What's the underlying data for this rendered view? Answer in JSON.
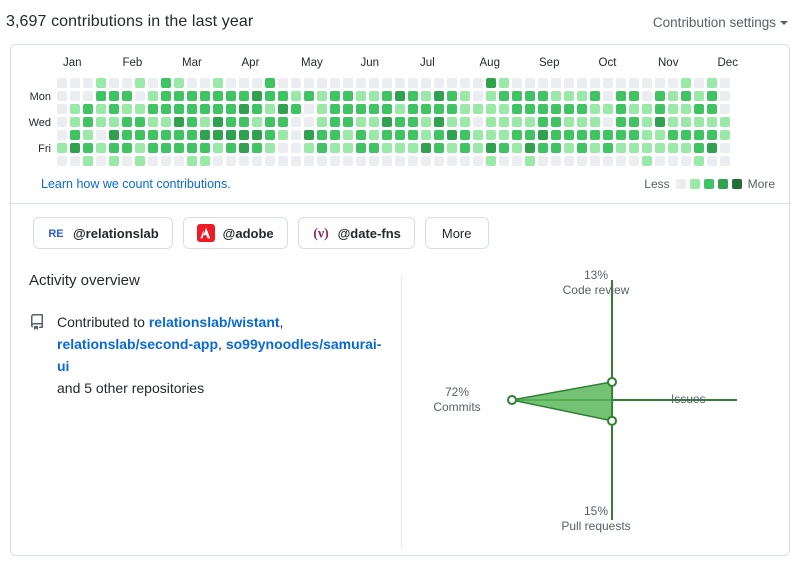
{
  "header": {
    "title": "3,697 contributions in the last year",
    "settings_label": "Contribution settings"
  },
  "calendar": {
    "months": [
      "Jan",
      "Feb",
      "Mar",
      "Apr",
      "May",
      "Jun",
      "Jul",
      "Aug",
      "Sep",
      "Oct",
      "Nov",
      "Dec"
    ],
    "days": [
      "Mon",
      "Wed",
      "Fri"
    ],
    "learn_link": "Learn how we count contributions.",
    "legend": {
      "less_label": "Less",
      "more_label": "More",
      "colors": [
        "#ebedf0",
        "#9be9a8",
        "#40c463",
        "#30a14e",
        "#216e39"
      ]
    },
    "levels": [
      [
        0,
        0,
        0,
        0,
        0,
        1,
        0
      ],
      [
        0,
        0,
        1,
        1,
        2,
        3,
        0
      ],
      [
        0,
        0,
        2,
        2,
        1,
        2,
        1
      ],
      [
        1,
        2,
        1,
        1,
        0,
        1,
        0
      ],
      [
        0,
        2,
        2,
        1,
        3,
        2,
        1
      ],
      [
        0,
        2,
        1,
        2,
        2,
        2,
        0
      ],
      [
        1,
        0,
        1,
        2,
        2,
        1,
        1
      ],
      [
        0,
        1,
        2,
        1,
        2,
        2,
        0
      ],
      [
        2,
        2,
        2,
        1,
        2,
        2,
        0
      ],
      [
        1,
        2,
        2,
        3,
        2,
        2,
        0
      ],
      [
        0,
        2,
        2,
        2,
        2,
        2,
        1
      ],
      [
        0,
        2,
        2,
        1,
        3,
        2,
        1
      ],
      [
        1,
        2,
        2,
        3,
        3,
        1,
        0
      ],
      [
        0,
        2,
        2,
        2,
        3,
        2,
        0
      ],
      [
        0,
        2,
        3,
        2,
        3,
        3,
        0
      ],
      [
        0,
        3,
        2,
        1,
        3,
        2,
        0
      ],
      [
        2,
        2,
        1,
        2,
        2,
        1,
        0
      ],
      [
        0,
        2,
        3,
        2,
        1,
        0,
        0
      ],
      [
        0,
        1,
        2,
        0,
        0,
        0,
        0
      ],
      [
        0,
        2,
        0,
        0,
        3,
        1,
        0
      ],
      [
        0,
        1,
        1,
        1,
        2,
        2,
        0
      ],
      [
        0,
        2,
        2,
        2,
        2,
        1,
        0
      ],
      [
        0,
        2,
        2,
        2,
        1,
        1,
        0
      ],
      [
        0,
        1,
        2,
        1,
        2,
        2,
        0
      ],
      [
        0,
        1,
        2,
        1,
        1,
        2,
        0
      ],
      [
        0,
        2,
        2,
        3,
        2,
        1,
        0
      ],
      [
        0,
        3,
        1,
        2,
        2,
        1,
        0
      ],
      [
        0,
        2,
        2,
        2,
        2,
        1,
        0
      ],
      [
        0,
        1,
        2,
        1,
        1,
        3,
        0
      ],
      [
        0,
        3,
        2,
        3,
        2,
        2,
        0
      ],
      [
        0,
        2,
        2,
        1,
        3,
        1,
        0
      ],
      [
        0,
        1,
        1,
        1,
        2,
        2,
        0
      ],
      [
        0,
        0,
        1,
        0,
        1,
        1,
        0
      ],
      [
        3,
        1,
        1,
        1,
        1,
        3,
        1
      ],
      [
        1,
        2,
        1,
        1,
        1,
        2,
        0
      ],
      [
        0,
        2,
        2,
        1,
        2,
        1,
        0
      ],
      [
        0,
        2,
        2,
        1,
        2,
        3,
        1
      ],
      [
        0,
        2,
        2,
        2,
        3,
        2,
        0
      ],
      [
        0,
        1,
        2,
        2,
        2,
        2,
        0
      ],
      [
        0,
        1,
        2,
        1,
        2,
        1,
        0
      ],
      [
        0,
        1,
        2,
        1,
        2,
        2,
        0
      ],
      [
        0,
        2,
        1,
        1,
        2,
        1,
        0
      ],
      [
        0,
        0,
        1,
        0,
        2,
        2,
        0
      ],
      [
        0,
        2,
        2,
        2,
        2,
        1,
        0
      ],
      [
        0,
        2,
        1,
        2,
        2,
        1,
        0
      ],
      [
        0,
        0,
        1,
        1,
        1,
        1,
        1
      ],
      [
        0,
        2,
        2,
        3,
        1,
        1,
        0
      ],
      [
        0,
        1,
        1,
        1,
        2,
        1,
        0
      ],
      [
        1,
        2,
        1,
        1,
        2,
        1,
        0
      ],
      [
        0,
        1,
        2,
        1,
        2,
        2,
        1
      ],
      [
        1,
        2,
        2,
        1,
        2,
        3,
        0
      ],
      [
        0,
        0,
        0,
        1,
        1,
        0,
        0
      ]
    ]
  },
  "organizations": [
    {
      "name": "@relationslab",
      "icon": "relationslab-logo-icon"
    },
    {
      "name": "@adobe",
      "icon": "adobe-logo-icon"
    },
    {
      "name": "@date-fns",
      "icon": "datefns-logo-icon"
    }
  ],
  "orgs_more_label": "More",
  "activity": {
    "title": "Activity overview",
    "prefix": "Contributed to ",
    "repos": [
      "relationslab/wistant",
      "relationslab/second-app",
      "so99ynoodles/samurai-ui"
    ],
    "suffix": "and 5 other repositories"
  },
  "chart_data": {
    "type": "radar",
    "title": "",
    "axes": [
      "Code review",
      "Issues",
      "Pull requests",
      "Commits"
    ],
    "values": [
      13,
      null,
      15,
      72
    ],
    "labels": [
      "13%",
      "",
      "15%",
      "72%"
    ],
    "unit": "%",
    "colors": {
      "fill": "#5cb85c",
      "stroke": "#2f8132",
      "axis": "#2f8132",
      "point": "#ffffff"
    }
  }
}
